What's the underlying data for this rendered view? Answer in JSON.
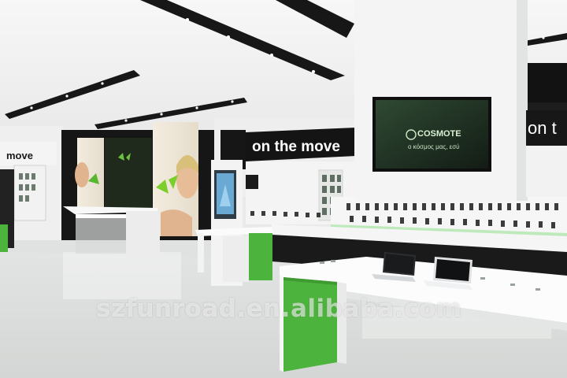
{
  "signage": {
    "slogan_main": "on the move",
    "slogan_left": "move",
    "slogan_right": "on t",
    "tv_brand": "COSMOTE",
    "tv_tagline": "ο κόσμος μας, εσύ"
  },
  "watermark": {
    "text": "szfunroad.en.alibaba.com"
  },
  "colors": {
    "accent_green": "#4cb43c",
    "wall_white": "#f4f5f4",
    "ceiling_black": "#151515",
    "tv_screen": "#1c2a1e"
  }
}
